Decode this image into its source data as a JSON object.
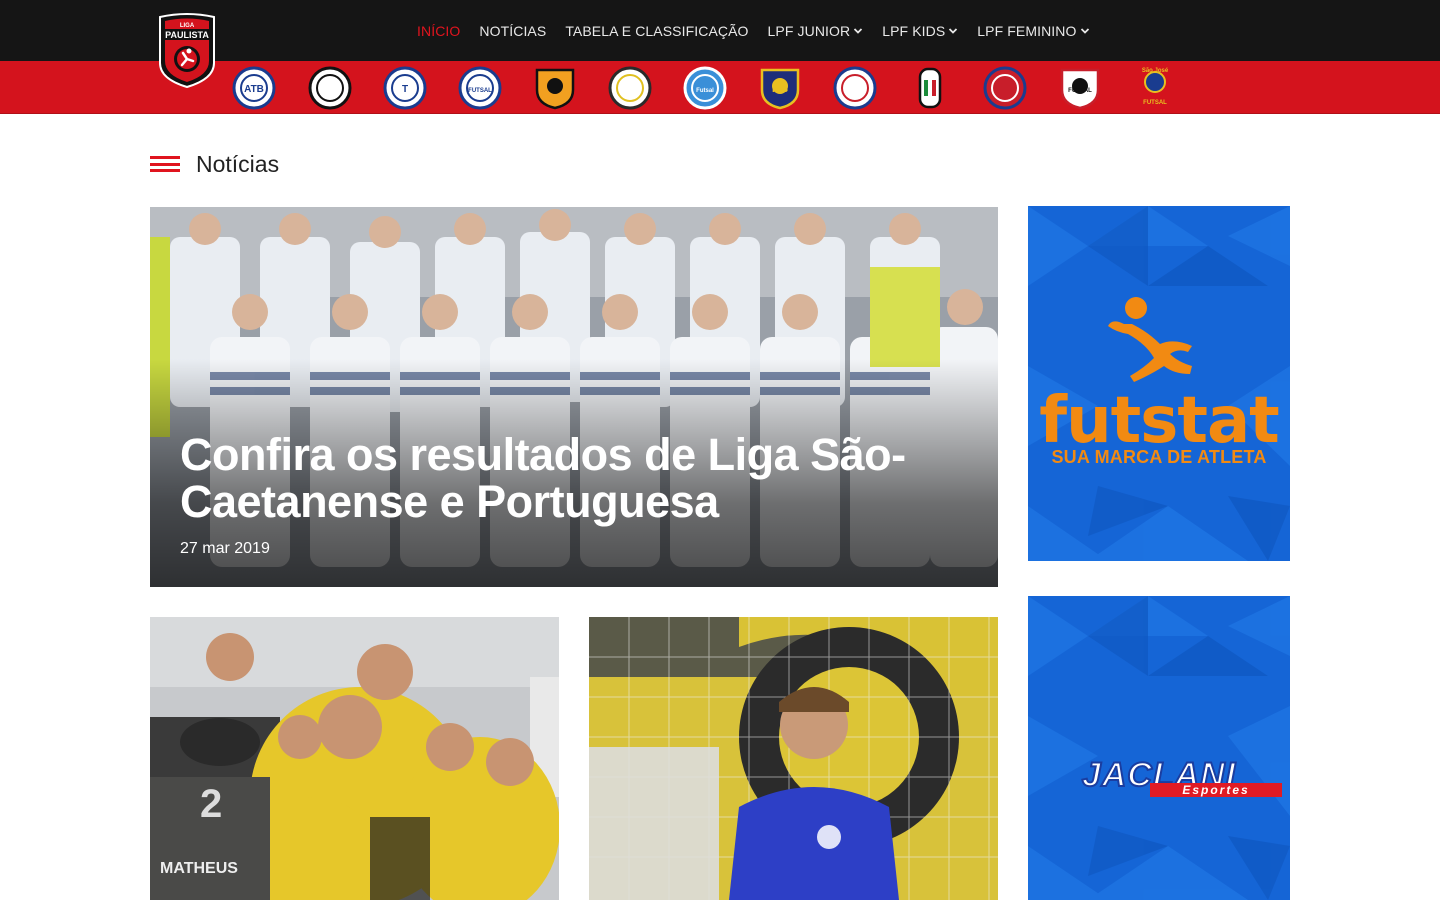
{
  "brand": {
    "logo_top": "LIGA",
    "logo_name": "PAULISTA"
  },
  "nav": {
    "items": [
      {
        "label": "INÍCIO",
        "active": true,
        "dropdown": false
      },
      {
        "label": "NOTÍCIAS",
        "active": false,
        "dropdown": false
      },
      {
        "label": "TABELA E CLASSIFICAÇÃO",
        "active": false,
        "dropdown": false
      },
      {
        "label": "LPF JUNIOR",
        "active": false,
        "dropdown": true
      },
      {
        "label": "LPF KIDS",
        "active": false,
        "dropdown": true
      },
      {
        "label": "LPF FEMININO",
        "active": false,
        "dropdown": true
      }
    ]
  },
  "clubs": [
    {
      "name": "club-1",
      "text": "ATB"
    },
    {
      "name": "club-2",
      "text": ""
    },
    {
      "name": "club-3",
      "text": "T"
    },
    {
      "name": "club-4",
      "text": "FUTSAL"
    },
    {
      "name": "club-5",
      "text": ""
    },
    {
      "name": "club-6",
      "text": ""
    },
    {
      "name": "club-7",
      "text": "Futsal"
    },
    {
      "name": "club-8",
      "text": "FIB"
    },
    {
      "name": "club-9",
      "text": ""
    },
    {
      "name": "club-10",
      "text": ""
    },
    {
      "name": "club-11",
      "text": ""
    },
    {
      "name": "club-12",
      "text": "FUTSAL"
    },
    {
      "name": "club-13",
      "text": "FUTSAL",
      "top": "São José"
    }
  ],
  "section": {
    "title": "Notícias"
  },
  "featured": {
    "title": "Confira os resultados de Liga São-Caetanense e Portuguesa",
    "date": "27 mar 2019"
  },
  "cards": [
    {
      "jersey_name": "MATHEUS"
    },
    {
      "jersey_name": ""
    }
  ],
  "ads": [
    {
      "brand": "futstat",
      "tagline": "SUA MARCA DE ATLETA"
    },
    {
      "brand": "JACLANI",
      "tagline": "Esportes"
    }
  ],
  "colors": {
    "accent": "#e0141e",
    "dark": "#151515",
    "ad_blue": "#1463d1",
    "futstat_orange": "#f28a12"
  }
}
